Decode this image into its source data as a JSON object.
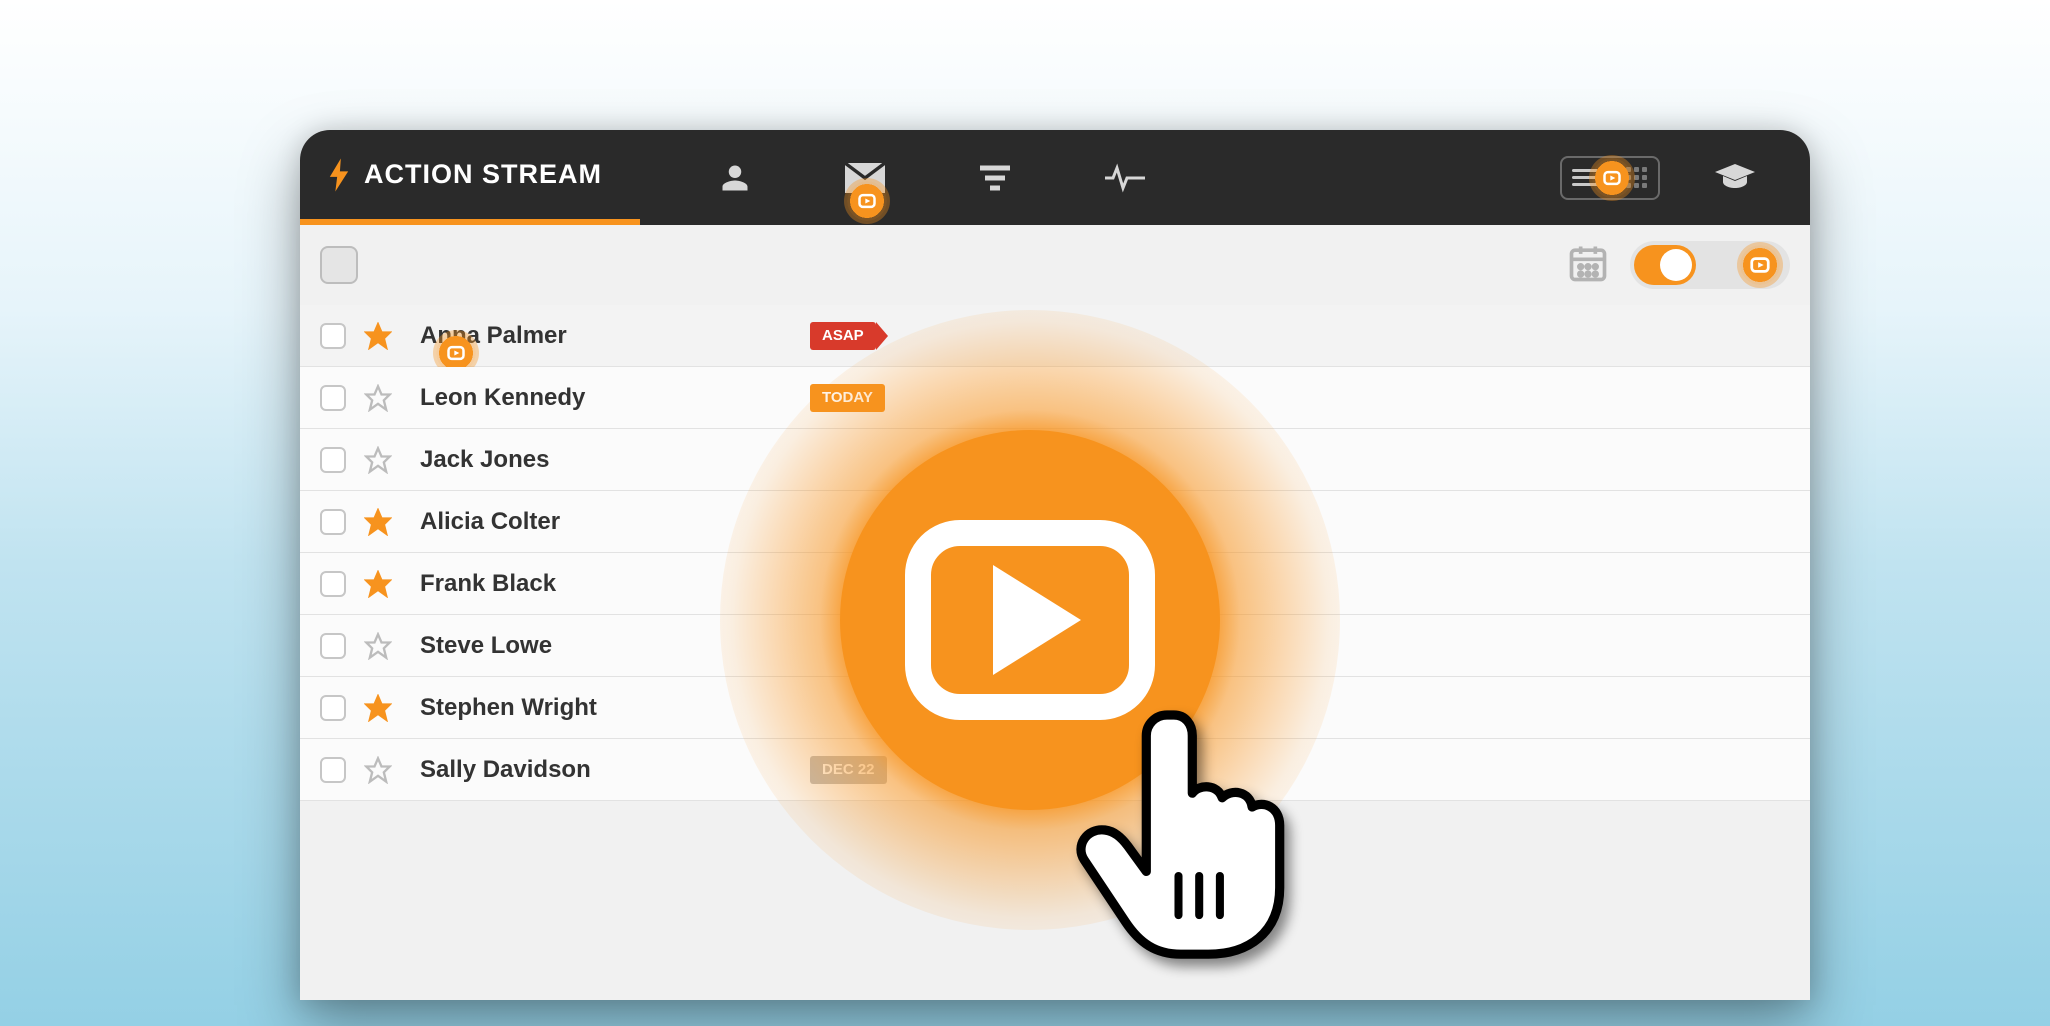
{
  "header": {
    "title": "ACTION STREAM"
  },
  "rows": [
    {
      "name": "Anna Palmer",
      "starred": true,
      "badge": "ASAP",
      "badge_kind": "asap",
      "hotspot": true
    },
    {
      "name": "Leon Kennedy",
      "starred": false,
      "badge": "TODAY",
      "badge_kind": "today",
      "hotspot": false
    },
    {
      "name": "Jack Jones",
      "starred": false,
      "badge": "",
      "badge_kind": "",
      "hotspot": false
    },
    {
      "name": "Alicia Colter",
      "starred": true,
      "badge": "",
      "badge_kind": "",
      "hotspot": false
    },
    {
      "name": "Frank Black",
      "starred": true,
      "badge": "",
      "badge_kind": "",
      "hotspot": false
    },
    {
      "name": "Steve Lowe",
      "starred": false,
      "badge": "",
      "badge_kind": "",
      "hotspot": false
    },
    {
      "name": "Stephen Wright",
      "starred": true,
      "badge": "",
      "badge_kind": "",
      "hotspot": false
    },
    {
      "name": "Sally Davidson",
      "starred": false,
      "badge": "DEC 22",
      "badge_kind": "date",
      "hotspot": false
    }
  ]
}
